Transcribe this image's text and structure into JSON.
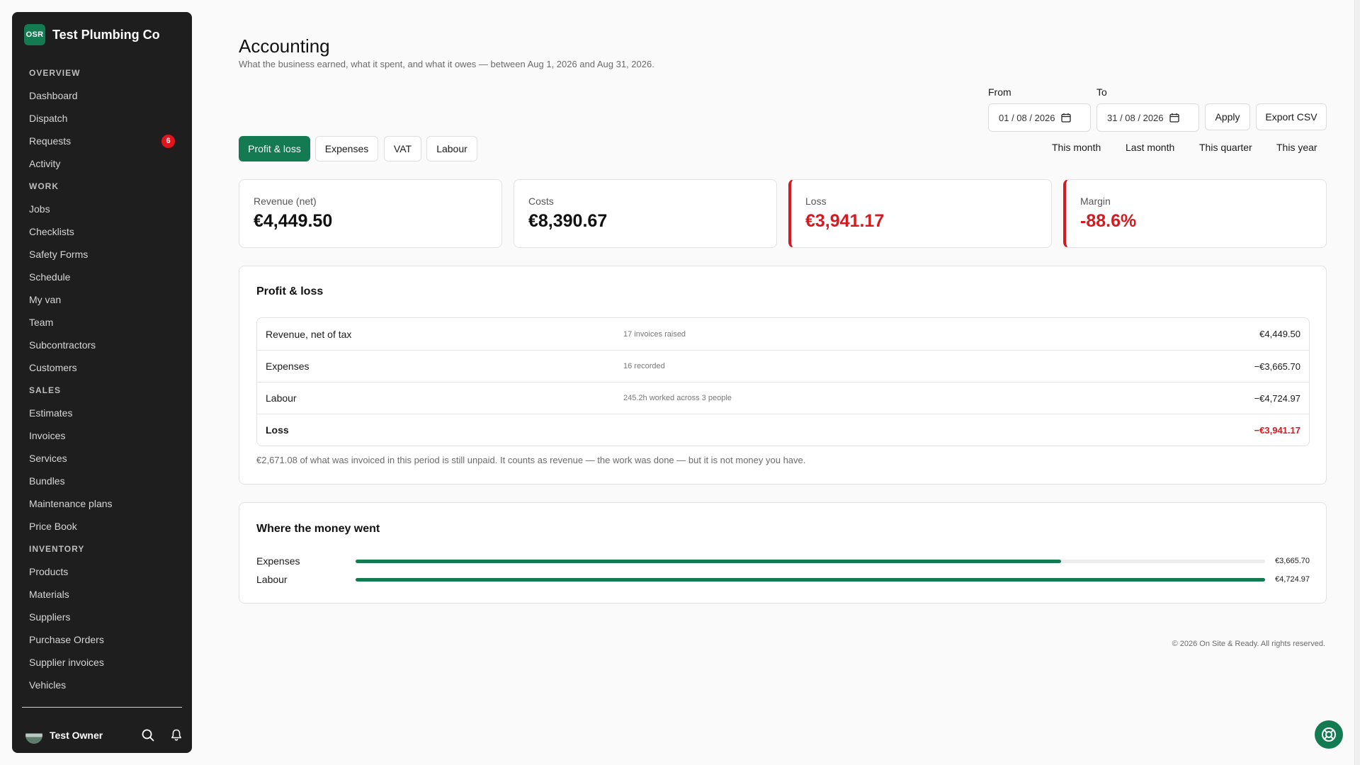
{
  "app": {
    "brand_logo": "OSR",
    "brand_name": "Test Plumbing Co",
    "accent_color": "#137a52",
    "negative_color": "#d61a1f"
  },
  "sidebar": {
    "sections": [
      {
        "title": "OVERVIEW",
        "items": [
          {
            "label": "Dashboard"
          },
          {
            "label": "Dispatch"
          },
          {
            "label": "Requests",
            "badge": "6"
          },
          {
            "label": "Activity"
          }
        ]
      },
      {
        "title": "WORK",
        "items": [
          {
            "label": "Jobs"
          },
          {
            "label": "Checklists"
          },
          {
            "label": "Safety Forms"
          },
          {
            "label": "Schedule"
          },
          {
            "label": "My van"
          },
          {
            "label": "Team"
          },
          {
            "label": "Subcontractors"
          },
          {
            "label": "Customers"
          }
        ]
      },
      {
        "title": "SALES",
        "items": [
          {
            "label": "Estimates"
          },
          {
            "label": "Invoices"
          },
          {
            "label": "Services"
          },
          {
            "label": "Bundles"
          },
          {
            "label": "Maintenance plans"
          },
          {
            "label": "Price Book"
          }
        ]
      },
      {
        "title": "INVENTORY",
        "items": [
          {
            "label": "Products"
          },
          {
            "label": "Materials"
          },
          {
            "label": "Suppliers"
          },
          {
            "label": "Purchase Orders"
          },
          {
            "label": "Supplier invoices"
          },
          {
            "label": "Vehicles"
          }
        ]
      }
    ],
    "footer": {
      "owner_name": "Test Owner",
      "search_icon": "search-icon",
      "bell_icon": "bell-icon"
    }
  },
  "header": {
    "title": "Accounting",
    "subtitle": "What the business earned, what it spent, and what it owes — between Aug 1, 2026 and Aug 31, 2026."
  },
  "filters": {
    "from_label": "From",
    "from_value": "01 / 08 / 2026",
    "to_label": "To",
    "to_value": "31 / 08 / 2026",
    "apply_label": "Apply",
    "export_label": "Export CSV",
    "quick_ranges": [
      "This month",
      "Last month",
      "This quarter",
      "This year"
    ]
  },
  "tabs": [
    {
      "label": "Profit & loss",
      "active": true
    },
    {
      "label": "Expenses",
      "active": false
    },
    {
      "label": "VAT",
      "active": false
    },
    {
      "label": "Labour",
      "active": false
    }
  ],
  "kpis": [
    {
      "label": "Revenue (net)",
      "value": "€4,449.50",
      "negative": false
    },
    {
      "label": "Costs",
      "value": "€8,390.67",
      "negative": false
    },
    {
      "label": "Loss",
      "value": "€3,941.17",
      "negative": true
    },
    {
      "label": "Margin",
      "value": "-88.6%",
      "negative": true
    }
  ],
  "profit_loss": {
    "title": "Profit & loss",
    "rows": [
      {
        "label": "Revenue, net of tax",
        "note": "17 invoices raised",
        "amount": "€4,449.50"
      },
      {
        "label": "Expenses",
        "note": "16 recorded",
        "amount": "−€3,665.70"
      },
      {
        "label": "Labour",
        "note": "245.2h worked across 3 people",
        "amount": "−€4,724.97"
      },
      {
        "label": "Loss",
        "note": "",
        "amount": "−€3,941.17",
        "total": true
      }
    ],
    "footnote": "€2,671.08 of what was invoiced in this period is still unpaid. It counts as revenue — the work was done — but it is not money you have."
  },
  "money_went": {
    "title": "Where the money went",
    "bars": [
      {
        "label": "Expenses",
        "value": "€3,665.70",
        "amount": 3665.7
      },
      {
        "label": "Labour",
        "value": "€4,724.97",
        "amount": 4724.97
      }
    ]
  },
  "footer": {
    "copyright": "© 2026 On Site & Ready. All rights reserved."
  },
  "help": {
    "icon": "lifebuoy-icon"
  }
}
